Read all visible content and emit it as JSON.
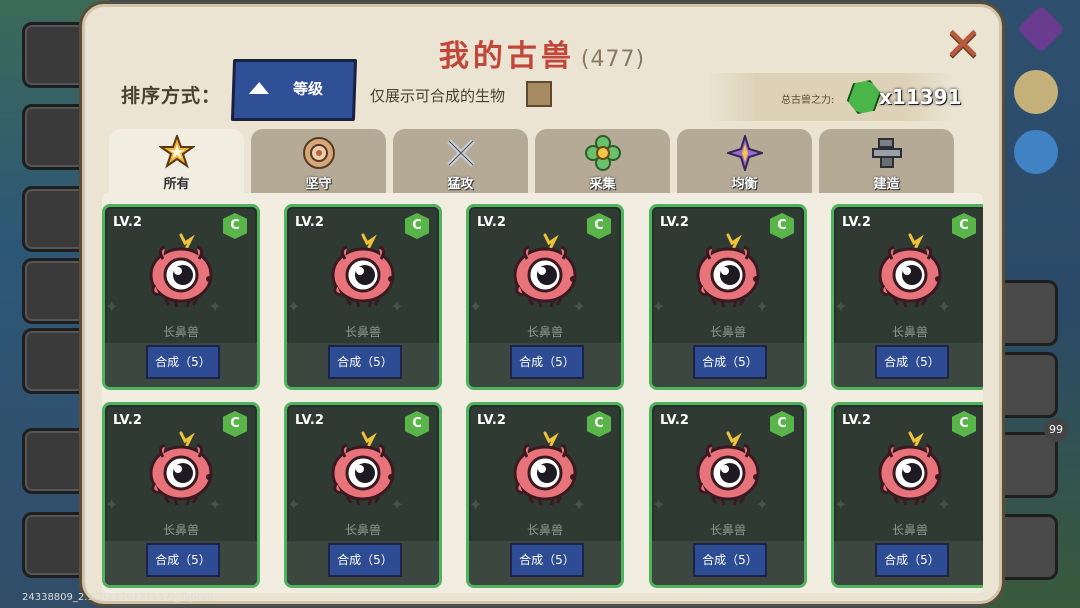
{
  "panel": {
    "title": "我的古兽",
    "count": "(477)"
  },
  "sort": {
    "label": "排序方式：",
    "button_label": "等级"
  },
  "filter": {
    "only_mergeable_label": "仅展示可合成的生物"
  },
  "power": {
    "label": "总古兽之力:",
    "value": "x11391"
  },
  "tabs": [
    {
      "label": "所有",
      "icon": "star-icon",
      "active": true
    },
    {
      "label": "坚守",
      "icon": "shield-icon",
      "active": false
    },
    {
      "label": "猛攻",
      "icon": "swords-icon",
      "active": false
    },
    {
      "label": "采集",
      "icon": "flower-icon",
      "active": false
    },
    {
      "label": "均衡",
      "icon": "compass-icon",
      "active": false
    },
    {
      "label": "建造",
      "icon": "anvil-icon",
      "active": false
    }
  ],
  "creatures": [
    {
      "level": "LV.2",
      "badge": "C",
      "name": "长鼻兽",
      "merge_label": "合成（5）"
    },
    {
      "level": "LV.2",
      "badge": "C",
      "name": "长鼻兽",
      "merge_label": "合成（5）"
    },
    {
      "level": "LV.2",
      "badge": "C",
      "name": "长鼻兽",
      "merge_label": "合成（5）"
    },
    {
      "level": "LV.2",
      "badge": "C",
      "name": "长鼻兽",
      "merge_label": "合成（5）"
    },
    {
      "level": "LV.2",
      "badge": "C",
      "name": "长鼻兽",
      "merge_label": "合成（5）"
    },
    {
      "level": "LV.2",
      "badge": "C",
      "name": "长鼻兽",
      "merge_label": "合成（5）"
    },
    {
      "level": "LV.2",
      "badge": "C",
      "name": "长鼻兽",
      "merge_label": "合成（5）"
    },
    {
      "level": "LV.2",
      "badge": "C",
      "name": "长鼻兽",
      "merge_label": "合成（5）"
    },
    {
      "level": "LV.2",
      "badge": "C",
      "name": "长鼻兽",
      "merge_label": "合成（5）"
    },
    {
      "level": "LV.2",
      "badge": "C",
      "name": "长鼻兽",
      "merge_label": "合成（5）"
    }
  ],
  "right_sidebar": {
    "badge_count": "99"
  },
  "footer": {
    "version": "24338809_2.9.2(2110131117)_Taptap"
  },
  "colors": {
    "title": "#c0473a",
    "card_border": "#4fb25c",
    "button_blue": "#2f4f96",
    "creature_pink": "#e8737a"
  }
}
